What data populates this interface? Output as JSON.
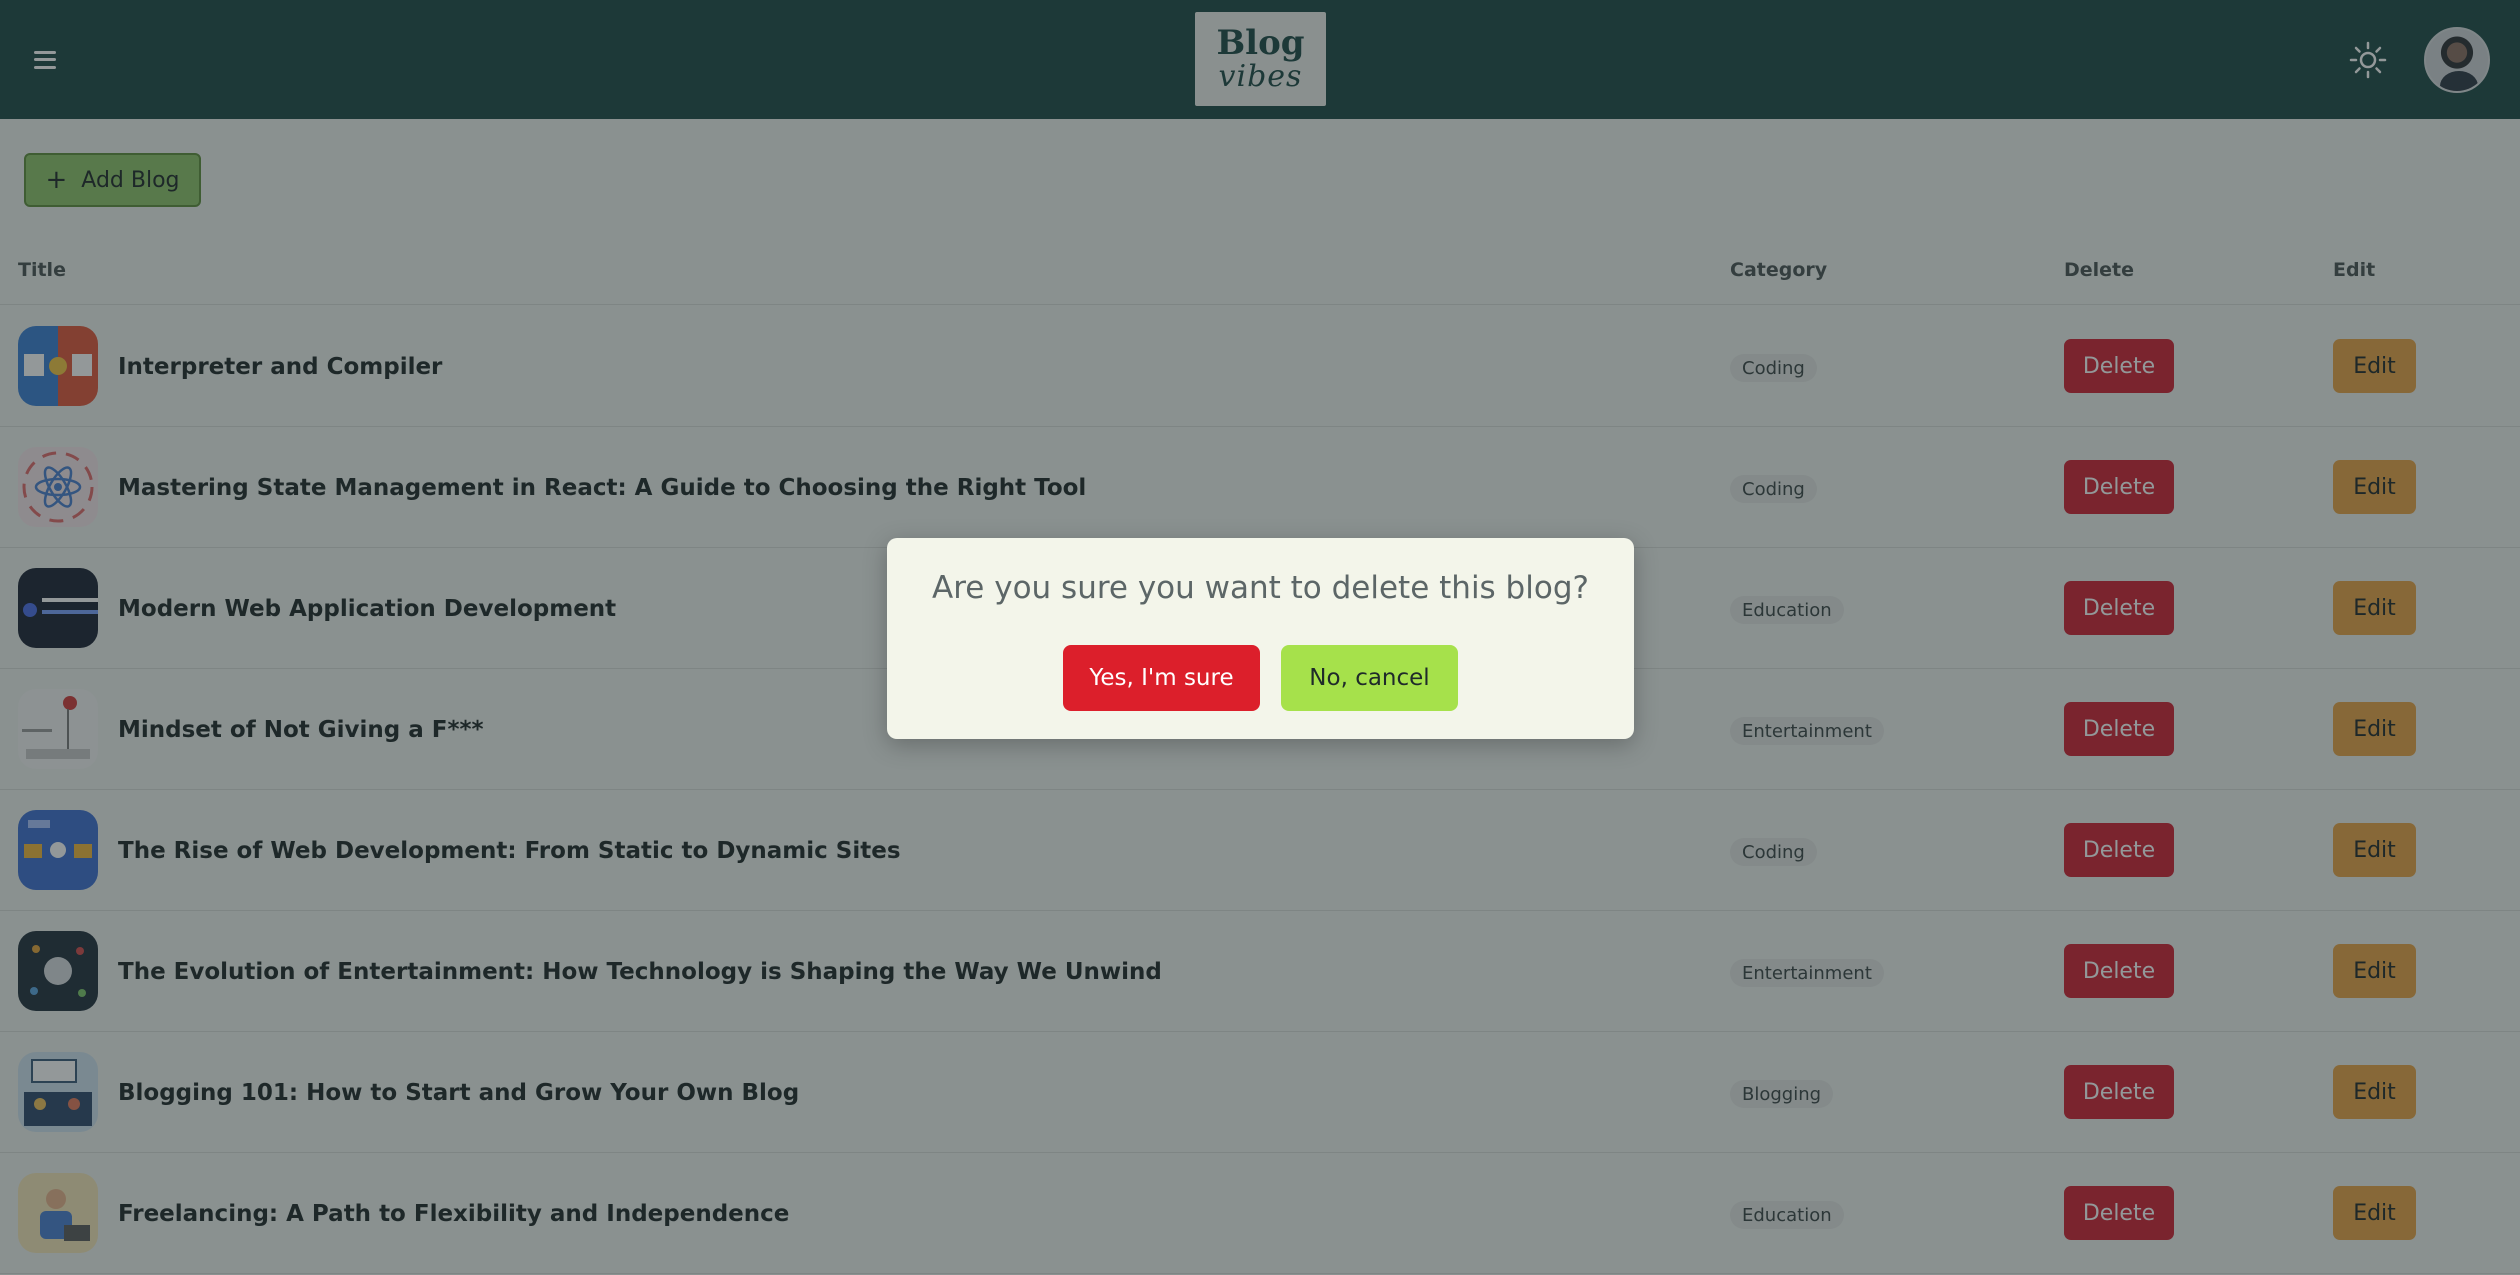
{
  "header": {
    "logo_line1": "Blog",
    "logo_line2": "vibes"
  },
  "toolbar": {
    "add_blog_label": "Add Blog",
    "add_icon": "+"
  },
  "table": {
    "columns": [
      "Title",
      "Category",
      "Delete",
      "Edit"
    ],
    "delete_label": "Delete",
    "edit_label": "Edit",
    "rows": [
      {
        "title": "Interpreter and Compiler",
        "category": "Coding",
        "thumb": "compiler-vs-interpreter-thumbnail"
      },
      {
        "title": "Mastering State Management in React: A Guide to Choosing the Right Tool",
        "category": "Coding",
        "thumb": "react-atom-thumbnail"
      },
      {
        "title": "Modern Web Application Development",
        "category": "Education",
        "thumb": "web-developer-roadmap-thumbnail"
      },
      {
        "title": "Mindset of Not Giving a F***",
        "category": "Entertainment",
        "thumb": "mindset-illustration-thumbnail"
      },
      {
        "title": "The Rise of Web Development: From Static to Dynamic Sites",
        "category": "Coding",
        "thumb": "static-vs-dynamic-thumbnail"
      },
      {
        "title": "The Evolution of Entertainment: How Technology is Shaping the Way We Unwind",
        "category": "Entertainment",
        "thumb": "entertainment-tech-thumbnail"
      },
      {
        "title": "Blogging 101: How to Start and Grow Your Own Blog",
        "category": "Blogging",
        "thumb": "blog-illustration-thumbnail"
      },
      {
        "title": "Freelancing: A Path to Flexibility and Independence",
        "category": "Education",
        "thumb": "freelancer-illustration-thumbnail"
      }
    ]
  },
  "modal": {
    "question": "Are you sure you want to delete this blog?",
    "confirm_label": "Yes, I'm sure",
    "cancel_label": "No, cancel"
  },
  "colors": {
    "header_bg": "#1d4a46",
    "add_button": "#8ec46a",
    "delete_button": "#cf2233",
    "edit_button": "#e8a346",
    "confirm_button": "#dc1f2b",
    "cancel_button": "#a6e14b"
  }
}
